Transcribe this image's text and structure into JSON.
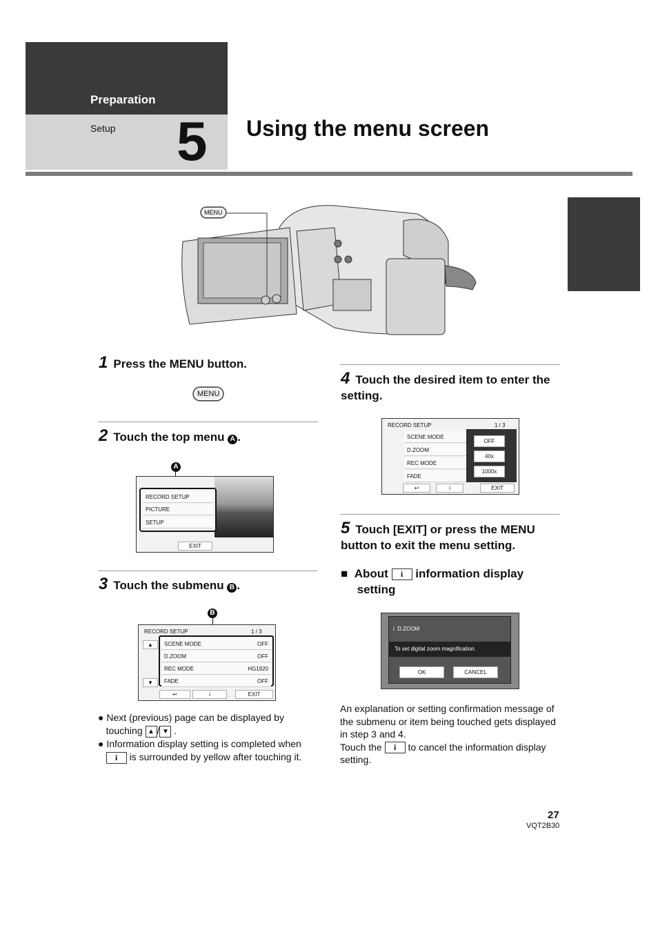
{
  "header": {
    "section": "Preparation",
    "subsection": "Setup",
    "chapter_number": "5",
    "title": "Using the menu screen"
  },
  "camera": {
    "menu_label": "MENU"
  },
  "steps": [
    {
      "num": "1",
      "text": "Press the MENU button.",
      "button": "MENU"
    },
    {
      "num": "2",
      "text": "Touch the top menu",
      "marker": "A"
    },
    {
      "num": "3",
      "text": "Touch the submenu",
      "marker": "B"
    },
    {
      "num": "4",
      "text": "Touch the desired item to enter the setting."
    },
    {
      "num": "5",
      "text": "Touch [EXIT] or press the MENU button to exit the menu setting."
    }
  ],
  "top_menu": {
    "items": [
      "RECORD SETUP",
      "PICTURE",
      "SETUP"
    ],
    "exit": "EXIT"
  },
  "submenu": {
    "header": "RECORD SETUP",
    "page": "1 / 3",
    "items": [
      {
        "label": "SCENE MODE",
        "value": "OFF"
      },
      {
        "label": "D.ZOOM",
        "value": "OFF"
      },
      {
        "label": "REC MODE",
        "value": "HG1920"
      },
      {
        "label": "FADE",
        "value": "OFF"
      }
    ],
    "exit": "EXIT",
    "info": "i",
    "back": "↩"
  },
  "setting_popup": {
    "options": [
      "OFF",
      "40x",
      "1000x"
    ]
  },
  "info_screen": {
    "item": "D.ZOOM",
    "message": "To set digital zoom magnification.",
    "ok": "OK",
    "cancel": "CANCEL"
  },
  "notes": {
    "bullet1_a": "Next (previous) page can be displayed by",
    "bullet1_b": "touching",
    "up": "▲",
    "slash": "/",
    "down": "▼",
    "period": ".",
    "bullet2_a": "Information display setting is completed when",
    "bullet2_b": "is surrounded by yellow after touching it."
  },
  "about": {
    "pre": "About",
    "icon": "i",
    "post": "information display",
    "post2": "setting"
  },
  "explanation": {
    "p1": "An explanation or setting confirmation message of the submenu or item being touched gets displayed in step 3 and 4.",
    "p2_a": "Touch the",
    "p2_b": "to cancel the information display setting."
  },
  "footer": {
    "page": "27",
    "code": "VQT2B30"
  }
}
